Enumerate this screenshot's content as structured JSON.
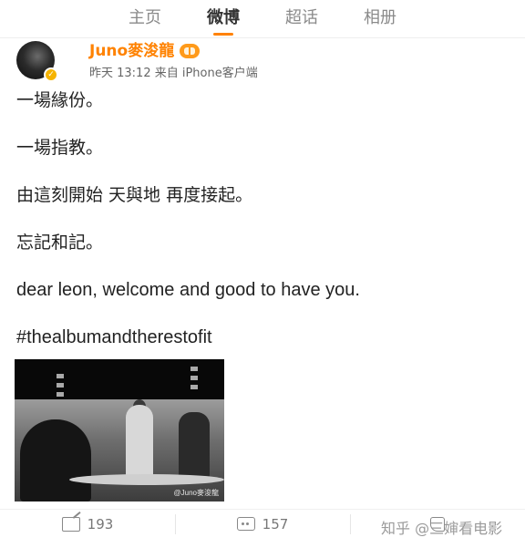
{
  "tabs": [
    {
      "label": "主页",
      "active": false
    },
    {
      "label": "微博",
      "active": true
    },
    {
      "label": "超话",
      "active": false
    },
    {
      "label": "相册",
      "active": false
    }
  ],
  "user": {
    "name": "Juno麥浚龍",
    "post_time": "昨天 13:12 来自 iPhone客户端"
  },
  "post": {
    "lines": [
      "一場緣份。",
      "一場指教。",
      "由這刻開始 天與地 再度接起。",
      "忘記和記。",
      "dear leon, welcome and good to have you.",
      "#thealbumandtherestofit"
    ],
    "image_watermark": "@Juno麥浚龍"
  },
  "actions": {
    "repost_count": "193",
    "comment_count": "157"
  },
  "watermark": "知乎 @三婶看电影",
  "colors": {
    "accent": "#ff8200",
    "text": "#222222",
    "muted": "#8a8a8a"
  }
}
